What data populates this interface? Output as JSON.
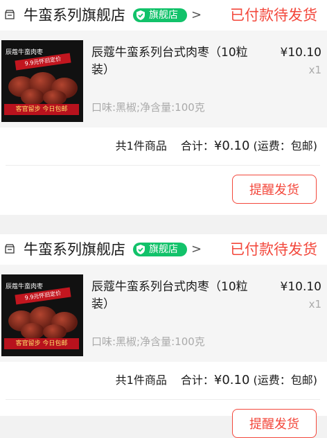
{
  "orders": [
    {
      "shop_name": "牛蛮系列旗舰店",
      "badge": "旗舰店",
      "status": "已付款待发货",
      "product": {
        "title": "辰蔻牛蛮系列台式肉枣（10粒装）",
        "price": "¥10.10",
        "qty": "x1",
        "spec": "口味:黑椒;净含量:100克",
        "image_text": {
          "brand": "辰蔻牛蛮肉枣",
          "promo": "9.9元怀旧定价",
          "strip": "客官留步 今日包邮"
        }
      },
      "summary": {
        "count": "共1件商品",
        "total_label": "合计：",
        "total": "¥0.10",
        "shipping": "(运费：包邮)"
      },
      "remind_label": "提醒发货"
    },
    {
      "shop_name": "牛蛮系列旗舰店",
      "badge": "旗舰店",
      "status": "已付款待发货",
      "product": {
        "title": "辰蔻牛蛮系列台式肉枣（10粒装）",
        "price": "¥10.10",
        "qty": "x1",
        "spec": "口味:黑椒;净含量:100克",
        "image_text": {
          "brand": "辰蔻牛蛮肉枣",
          "promo": "9.9元怀旧定价",
          "strip": "客官留步 今日包邮"
        }
      },
      "summary": {
        "count": "共1件商品",
        "total_label": "合计：",
        "total": "¥0.10",
        "shipping": "(运费：包邮)"
      },
      "remind_label": "提醒发货"
    }
  ],
  "colors": {
    "accent": "#f3473b",
    "badge": "#12c26a",
    "product_bg": "#f5f5f5",
    "page_bg": "#f2f2f2"
  },
  "icons": {
    "shop": "store-icon",
    "badge": "shield-check-icon",
    "chevron": "chevron-right-icon"
  }
}
